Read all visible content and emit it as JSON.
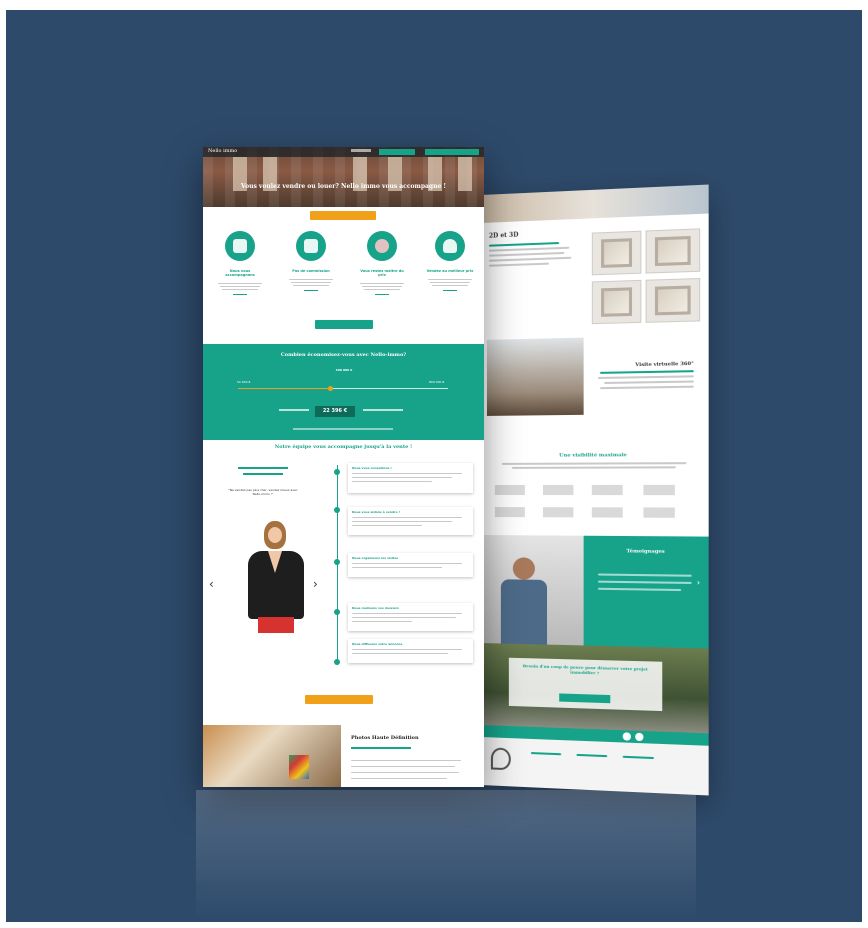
{
  "colors": {
    "background": "#2e4a6b",
    "accent_teal": "#16a38a",
    "accent_orange": "#f0a019"
  },
  "front": {
    "logo": "Nello immo",
    "hero_title": "Vous voulez vendre ou louer? Nello immo vous accompagne !",
    "features": [
      {
        "icon": "handshake-icon",
        "title": "Nous vous accompagnons"
      },
      {
        "icon": "computer-icon",
        "title": "Pas de commission"
      },
      {
        "icon": "piggy-bank-icon",
        "title": "Vous restez maître du prix"
      },
      {
        "icon": "agent-icon",
        "title": "Vendez au meilleur prix"
      }
    ],
    "calculator": {
      "title": "Combien économisez-vous avec Nello-immo?",
      "min": "50 000 €",
      "max": "800 000 €",
      "value": "300 000 €",
      "result": "22 396 €"
    },
    "team_title": "Notre équipe vous accompagne jusqu'à la vente !",
    "team_quote": "\"Ne vendez pas plus cher, vendez mieux avec Nello-immo !\"",
    "timeline": [
      "Nous vous conseillons !",
      "Nous vous aidons à vendre !",
      "Nous organisons les visites",
      "Nous réalisons vos dossiers",
      "Nous diffusons votre annonce"
    ],
    "footer_title": "Photos Haute Définition"
  },
  "back": {
    "sections": [
      "2D et 3D",
      "Visite virtuelle 360°",
      "Une visibilité maximale",
      "Témoignages",
      "Besoin d'un coup de pouce pour démarrer votre projet immobilier ?"
    ]
  }
}
